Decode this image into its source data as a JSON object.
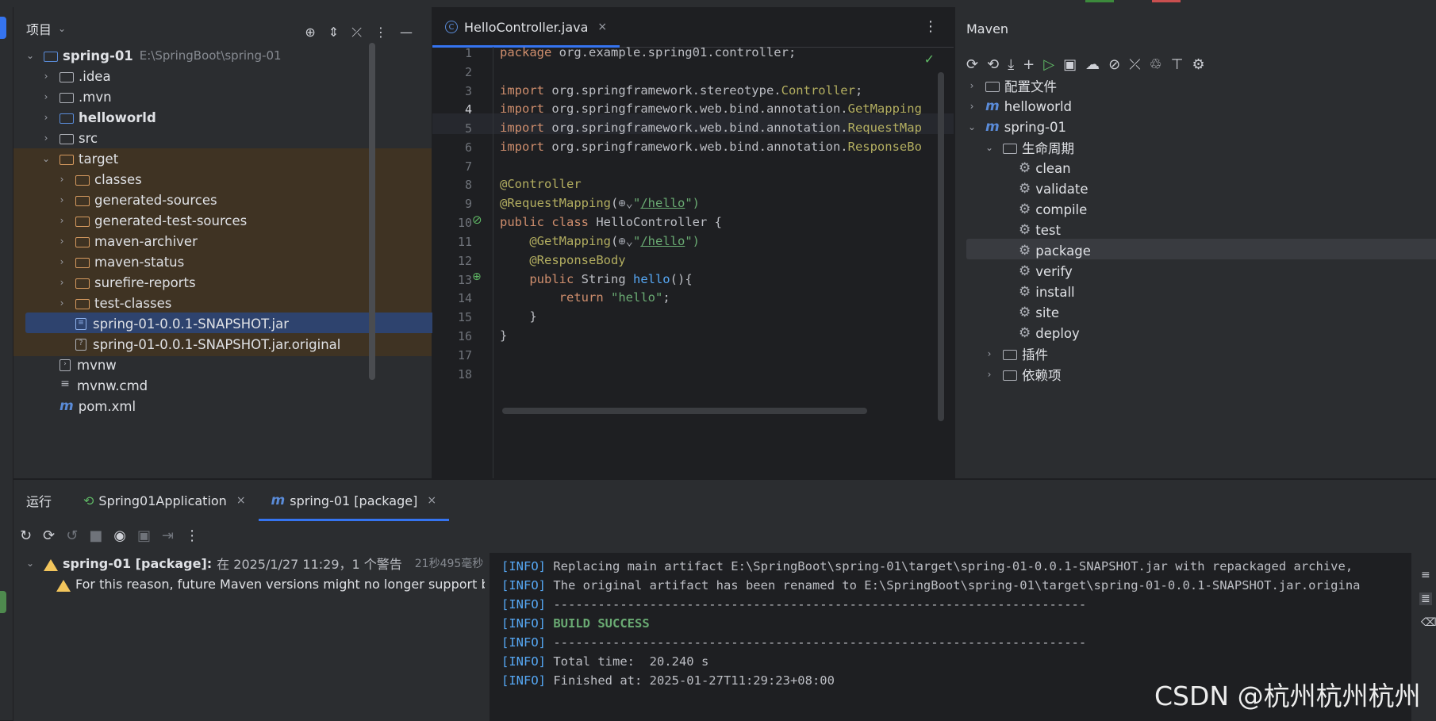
{
  "project": {
    "title": "项目",
    "tree": [
      {
        "name": "spring-01",
        "path": "E:\\SpringBoot\\spring-01",
        "chev": "v",
        "bold": true
      },
      {
        "name": ".idea",
        "chev": ">"
      },
      {
        "name": ".mvn",
        "chev": ">"
      },
      {
        "name": "helloworld",
        "chev": ">",
        "bold": true
      },
      {
        "name": "src",
        "chev": ">"
      },
      {
        "name": "target",
        "chev": "v"
      },
      {
        "name": "classes",
        "chev": ">"
      },
      {
        "name": "generated-sources",
        "chev": ">"
      },
      {
        "name": "generated-test-sources",
        "chev": ">"
      },
      {
        "name": "maven-archiver",
        "chev": ">"
      },
      {
        "name": "maven-status",
        "chev": ">"
      },
      {
        "name": "surefire-reports",
        "chev": ">"
      },
      {
        "name": "test-classes",
        "chev": ">"
      },
      {
        "name": "spring-01-0.0.1-SNAPSHOT.jar"
      },
      {
        "name": "spring-01-0.0.1-SNAPSHOT.jar.original"
      },
      {
        "name": "mvnw"
      },
      {
        "name": "mvnw.cmd"
      },
      {
        "name": "pom.xml"
      }
    ]
  },
  "editor": {
    "tab_label": "HelloController.java",
    "line_numbers": [
      "1",
      "2",
      "3",
      "4",
      "5",
      "6",
      "7",
      "8",
      "9",
      "10",
      "11",
      "12",
      "13",
      "14",
      "15",
      "16",
      "17",
      "18"
    ],
    "code": {
      "l1_kw": "package",
      "l1_rest": " org.example.spring01.controller;",
      "l3_kw": "import",
      "l3_rest": " org.springframework.stereotype.",
      "l3_cls": "Controller",
      "l3_end": ";",
      "l4_kw": "import",
      "l4_rest": " org.springframework.web.bind.annotation.",
      "l4_cls": "GetMapping",
      "l5_kw": "import",
      "l5_rest": " org.springframework.web.bind.annotation.",
      "l5_cls": "RequestMap",
      "l6_kw": "import",
      "l6_rest": " org.springframework.web.bind.annotation.",
      "l6_cls": "ResponseBo",
      "l8": "@Controller",
      "l9_ann": "@RequestMapping",
      "l9_open": "(",
      "l9_q": "\"",
      "l9_url": "/hello",
      "l9_close": "\")",
      "l10_kw1": "public",
      "l10_kw2": "class",
      "l10_rest": " HelloController {",
      "l11_ann": "@GetMapping",
      "l11_open": "(",
      "l11_q": "\"",
      "l11_url": "/hello",
      "l11_close": "\")",
      "l12": "@ResponseBody",
      "l13_kw": "public",
      "l13_type": " String ",
      "l13_fn": "hello",
      "l13_rest": "(){",
      "l14_kw": "return",
      "l14_str": "\"hello\"",
      "l14_end": ";",
      "l15": "}",
      "l16": "}"
    }
  },
  "maven": {
    "title": "Maven",
    "tree": [
      {
        "label": "配置文件",
        "chev": ">"
      },
      {
        "label": "helloworld",
        "chev": ">"
      },
      {
        "label": "spring-01",
        "chev": "v"
      },
      {
        "label": "生命周期",
        "chev": "v"
      },
      {
        "label": "clean"
      },
      {
        "label": "validate"
      },
      {
        "label": "compile"
      },
      {
        "label": "test"
      },
      {
        "label": "package"
      },
      {
        "label": "verify"
      },
      {
        "label": "install"
      },
      {
        "label": "site"
      },
      {
        "label": "deploy"
      },
      {
        "label": "插件",
        "chev": ">"
      },
      {
        "label": "依赖项",
        "chev": ">"
      }
    ]
  },
  "run": {
    "label": "运行",
    "tabs": [
      "Spring01Application",
      "spring-01 [package]"
    ],
    "tree_title": "spring-01 [package]:",
    "tree_meta": "在 2025/1/27 11:29，1 个警告",
    "tree_time": "21秒495毫秒",
    "warning_text": "For this reason, future Maven versions might no longer support bu",
    "console": [
      {
        "tag": "[INFO]",
        "text": " Replacing main artifact E:\\SpringBoot\\spring-01\\target\\spring-01-0.0.1-SNAPSHOT.jar with repackaged archive,"
      },
      {
        "tag": "[INFO]",
        "text": " The original artifact has been renamed to E:\\SpringBoot\\spring-01\\target\\spring-01-0.0.1-SNAPSHOT.jar.origina"
      },
      {
        "tag": "[INFO]",
        "text": " ------------------------------------------------------------------------"
      },
      {
        "tag": "[INFO]",
        "text": " BUILD SUCCESS"
      },
      {
        "tag": "[INFO]",
        "text": " ------------------------------------------------------------------------"
      },
      {
        "tag": "[INFO]",
        "text": " Total time:  20.240 s"
      },
      {
        "tag": "[INFO]",
        "text": " Finished at: 2025-01-27T11:29:23+08:00"
      }
    ]
  },
  "watermark": "CSDN @杭州杭州杭州",
  "icons": {
    "chevron_right": "›",
    "chevron_down": "⌄",
    "close": "×",
    "gear": "⚙",
    "more": "⋮"
  }
}
